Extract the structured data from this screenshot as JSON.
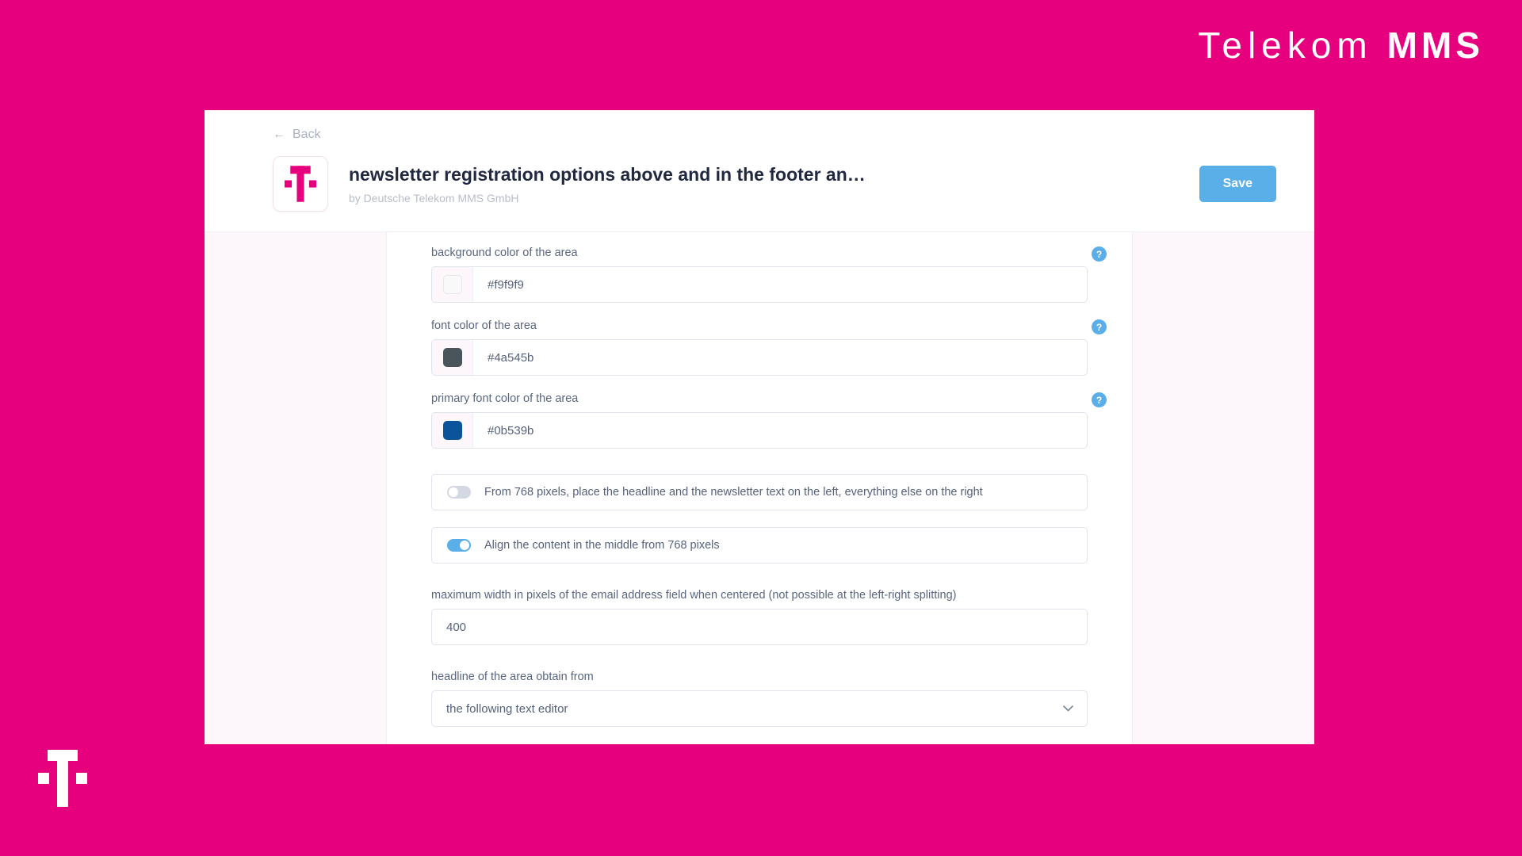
{
  "brand": {
    "word": "Telekom",
    "sub": "MMS",
    "corner_mark": "telekom-t-logo"
  },
  "card": {
    "back_label": "Back",
    "back_icon": "arrow-left-icon",
    "app_icon": "telekom-t-app-icon",
    "title": "newsletter registration options above and in the footer an…",
    "subtitle": "by Deutsche Telekom MMS GmbH",
    "save_label": "Save",
    "accent": "#e6007e",
    "button_color": "#5aafe8"
  },
  "form": {
    "help_glyph": "?",
    "fields": [
      {
        "label": "background color of the area",
        "value": "#f9f9f9",
        "swatch": "#f9f9f9",
        "help": true
      },
      {
        "label": "font color of the area",
        "value": "#4a545b",
        "swatch": "#4a545b",
        "help": true
      },
      {
        "label": "primary font color of the area",
        "value": "#0b539b",
        "swatch": "#0b539b",
        "help": true
      }
    ],
    "toggles": [
      {
        "label": "From 768 pixels, place the headline and the newsletter text on the left, everything else on the right",
        "on": false
      },
      {
        "label": "Align the content in the middle from 768 pixels",
        "on": true
      }
    ],
    "number_field": {
      "label": "maximum width in pixels of the email address field when centered (not possible at the left-right splitting)",
      "value": "400"
    },
    "select_field": {
      "label": "headline of the area obtain from",
      "value": "the following text editor",
      "chevron": "chevron-down-icon"
    }
  }
}
